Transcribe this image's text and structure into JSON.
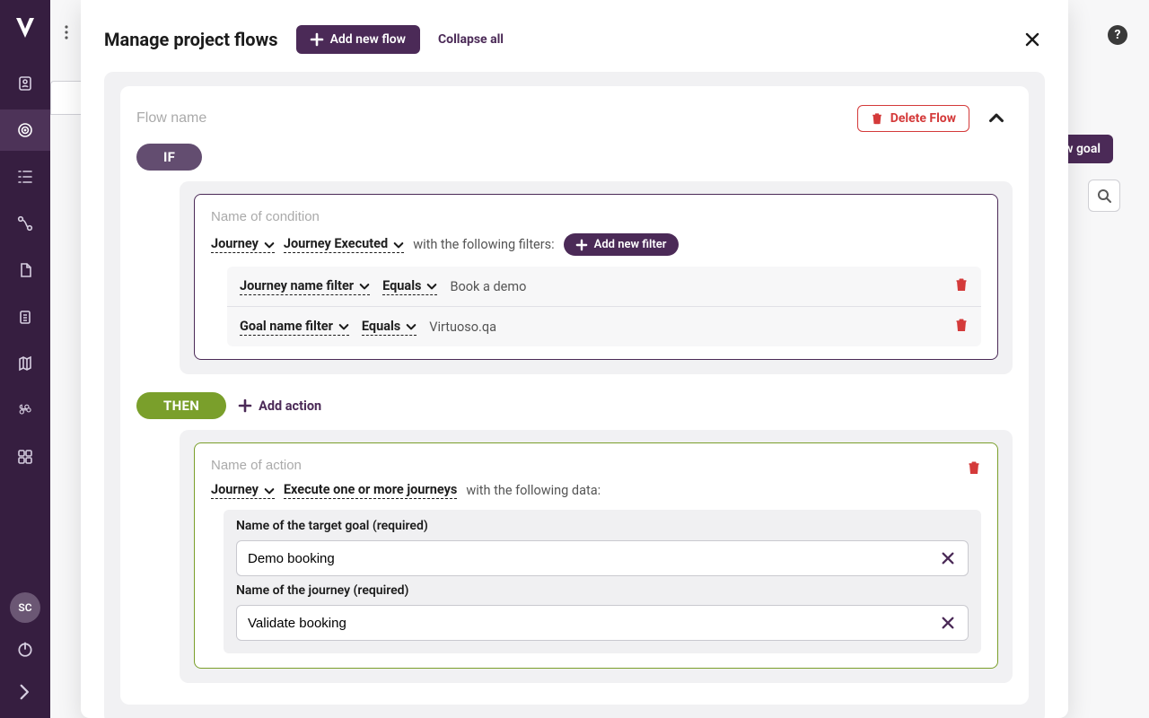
{
  "colors": {
    "brand": "#4b2a57",
    "danger": "#d43a3a",
    "then": "#7a9f2b",
    "if": "#634d70"
  },
  "sidebar": {
    "avatar_initials": "SC"
  },
  "bg": {
    "new_goal_label": "w goal",
    "help_label": "?"
  },
  "modal": {
    "title": "Manage project flows",
    "add_flow_label": "Add new flow",
    "collapse_label": "Collapse all"
  },
  "flow": {
    "name_placeholder": "Flow name",
    "delete_label": "Delete Flow",
    "if_label": "IF",
    "then_label": "THEN",
    "condition": {
      "name_placeholder": "Name of condition",
      "subject": "Journey",
      "event": "Journey Executed",
      "filters_intro": "with the following filters:",
      "add_filter_label": "Add new filter",
      "filters": [
        {
          "field": "Journey name filter",
          "op": "Equals",
          "value": "Book a demo"
        },
        {
          "field": "Goal name filter",
          "op": "Equals",
          "value": "Virtuoso.qa"
        }
      ]
    },
    "add_action_label": "Add action",
    "action": {
      "name_placeholder": "Name of action",
      "subject": "Journey",
      "verb": "Execute one or more journeys",
      "data_intro": "with the following data:",
      "fields": [
        {
          "label": "Name of the target goal (required)",
          "value": "Demo booking"
        },
        {
          "label": "Name of the journey (required)",
          "value": "Validate booking"
        }
      ]
    }
  }
}
